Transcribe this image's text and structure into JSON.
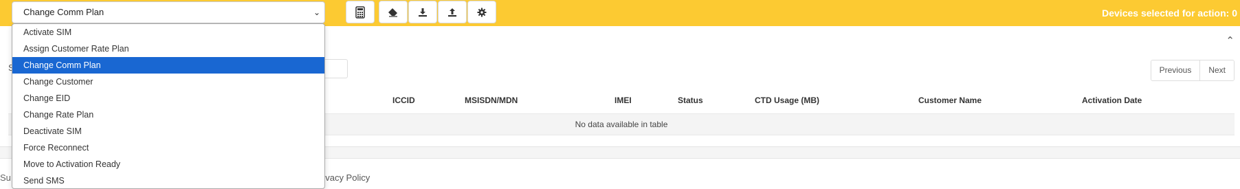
{
  "toolbar": {
    "selected_action": "Change Comm Plan",
    "devices_selected_text": "Devices selected for action: 0",
    "buttons": [
      {
        "name": "calculator-button",
        "icon": "calculator-icon"
      },
      {
        "name": "clear-button",
        "icon": "eraser-icon"
      },
      {
        "name": "download-button",
        "icon": "download-icon"
      },
      {
        "name": "upload-button",
        "icon": "upload-icon"
      },
      {
        "name": "settings-button",
        "icon": "gear-icon"
      }
    ],
    "accent_color": "#fcca32"
  },
  "action_menu": {
    "options": [
      {
        "label": "Activate SIM"
      },
      {
        "label": "Assign Customer Rate Plan"
      },
      {
        "label": "Change Comm Plan",
        "selected": true
      },
      {
        "label": "Change Customer"
      },
      {
        "label": "Change EID"
      },
      {
        "label": "Change Rate Plan"
      },
      {
        "label": "Deactivate SIM"
      },
      {
        "label": "Force Reconnect"
      },
      {
        "label": "Move to Activation Ready"
      },
      {
        "label": "Send SMS"
      }
    ],
    "highlight_color": "#1967d2"
  },
  "panel": {
    "search_label_fragment": "S",
    "pagination": {
      "previous": "Previous",
      "next": "Next"
    },
    "table": {
      "columns": [
        "ICCID",
        "MSISDN/MDN",
        "IMEI",
        "Status",
        "CTD Usage (MB)",
        "Customer Name",
        "Activation Date"
      ],
      "empty_message": "No data available in table"
    }
  },
  "footer": {
    "left_fragment": "Su",
    "privacy_link": "rivacy Policy"
  }
}
